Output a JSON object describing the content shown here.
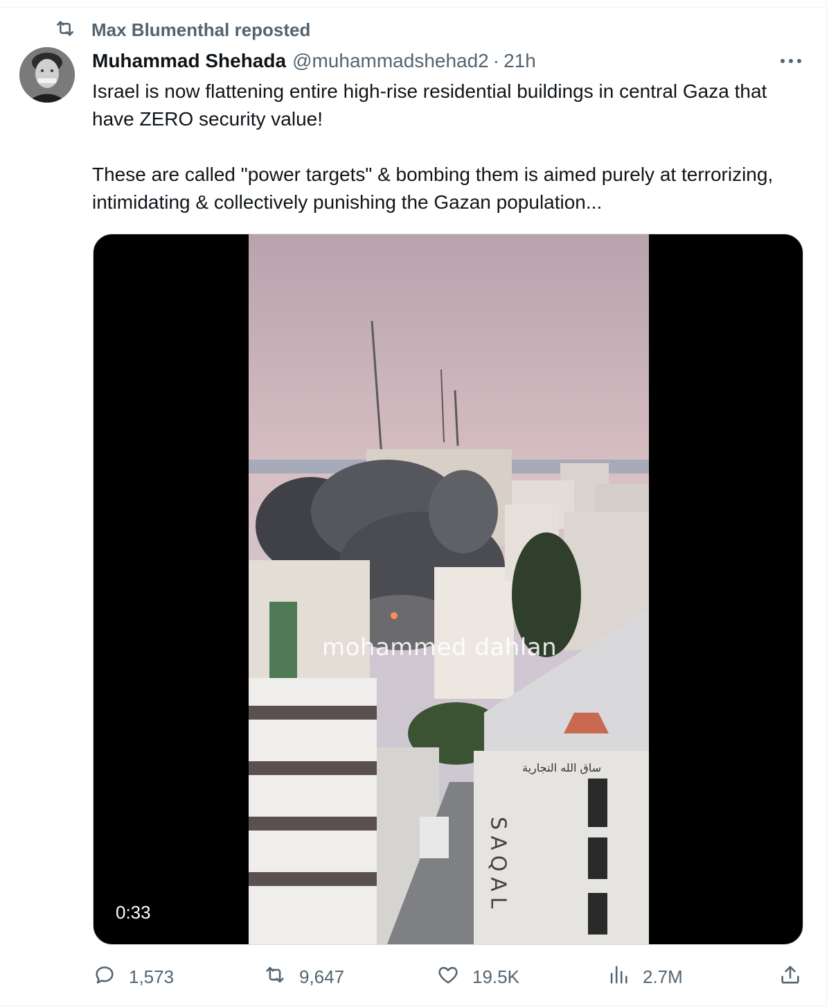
{
  "repost": {
    "icon": "repost-icon",
    "label": "Max Blumenthal reposted"
  },
  "author": {
    "display_name": "Muhammad Shehada",
    "handle": "@muhammadshehad2",
    "separator": "·",
    "time": "21h",
    "avatar_icon": "avatar-photo"
  },
  "more_icon": "more-icon",
  "tweet": {
    "paragraphs": [
      "Israel is now flattening entire high-rise residential buildings in central Gaza that have ZERO security value!",
      "These are called \"power targets\" & bombing them is aimed purely at terrorizing, intimidating & collectively punishing the Gazan population..."
    ]
  },
  "media": {
    "watermark": "mohammed dahlan",
    "sign_vertical": "SAQAL",
    "duration": "0:33"
  },
  "actions": {
    "reply": {
      "icon": "reply-icon",
      "count": "1,573"
    },
    "repost": {
      "icon": "repost-icon",
      "count": "9,647"
    },
    "like": {
      "icon": "heart-icon",
      "count": "19.5K"
    },
    "views": {
      "icon": "views-icon",
      "count": "2.7M"
    },
    "share": {
      "icon": "share-icon"
    }
  },
  "colors": {
    "text": "#0f1419",
    "secondary": "#536471",
    "border": "#cfd9de"
  }
}
